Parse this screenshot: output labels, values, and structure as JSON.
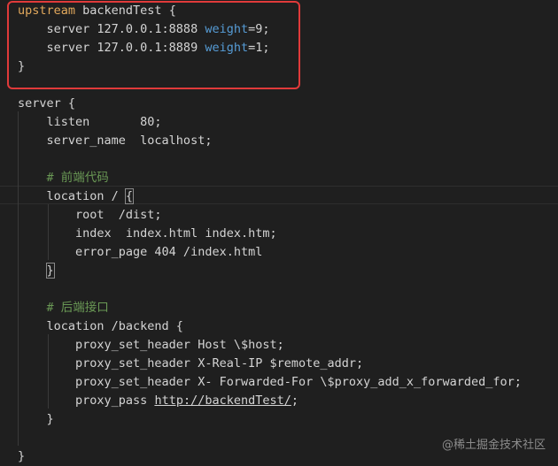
{
  "editor": {
    "lines": [
      [
        {
          "t": "upstream",
          "c": "keyword"
        },
        {
          "t": " backendTest {",
          "c": "plain"
        }
      ],
      [
        {
          "t": "    server 127.0.0.1:8888 ",
          "c": "plain"
        },
        {
          "t": "weight",
          "c": "prop"
        },
        {
          "t": "=9;",
          "c": "plain"
        }
      ],
      [
        {
          "t": "    server 127.0.0.1:8889 ",
          "c": "plain"
        },
        {
          "t": "weight",
          "c": "prop"
        },
        {
          "t": "=1;",
          "c": "plain"
        }
      ],
      [
        {
          "t": "}",
          "c": "plain"
        }
      ],
      [],
      [
        {
          "t": "server {",
          "c": "plain"
        }
      ],
      [
        {
          "t": "    listen       80;",
          "c": "plain"
        }
      ],
      [
        {
          "t": "    server_name  localhost;",
          "c": "plain"
        }
      ],
      [],
      [
        {
          "t": "    # 前端代码",
          "c": "comment"
        }
      ],
      [
        {
          "t": "    location / ",
          "c": "plain"
        },
        {
          "t": "{",
          "c": "bracket"
        }
      ],
      [
        {
          "t": "        root  /dist;",
          "c": "plain"
        }
      ],
      [
        {
          "t": "        index  index.html index.htm;",
          "c": "plain"
        }
      ],
      [
        {
          "t": "        error_page 404 /index.html",
          "c": "plain"
        }
      ],
      [
        {
          "t": "    ",
          "c": "plain"
        },
        {
          "t": "}",
          "c": "bracket"
        }
      ],
      [],
      [
        {
          "t": "    # 后端接口",
          "c": "comment"
        }
      ],
      [
        {
          "t": "    location /backend {",
          "c": "plain"
        }
      ],
      [
        {
          "t": "        proxy_set_header Host \\$host;",
          "c": "plain"
        }
      ],
      [
        {
          "t": "        proxy_set_header X-Real-IP $remote_addr;",
          "c": "plain"
        }
      ],
      [
        {
          "t": "        proxy_set_header X- Forwarded-For \\$proxy_add_x_forwarded_for;",
          "c": "plain"
        }
      ],
      [
        {
          "t": "        proxy_pass ",
          "c": "plain"
        },
        {
          "t": "http://backendTest/",
          "c": "link"
        },
        {
          "t": ";",
          "c": "plain"
        }
      ],
      [
        {
          "t": "    }",
          "c": "plain"
        }
      ],
      [],
      [
        {
          "t": "}",
          "c": "plain"
        }
      ]
    ]
  },
  "watermark": "@稀土掘金技术社区",
  "colors": {
    "background": "#1f1f1f",
    "keyword": "#e3a95c",
    "property": "#569cd6",
    "comment": "#6a9955",
    "text": "#d4d4d4",
    "highlight_border": "#e03a3a"
  }
}
